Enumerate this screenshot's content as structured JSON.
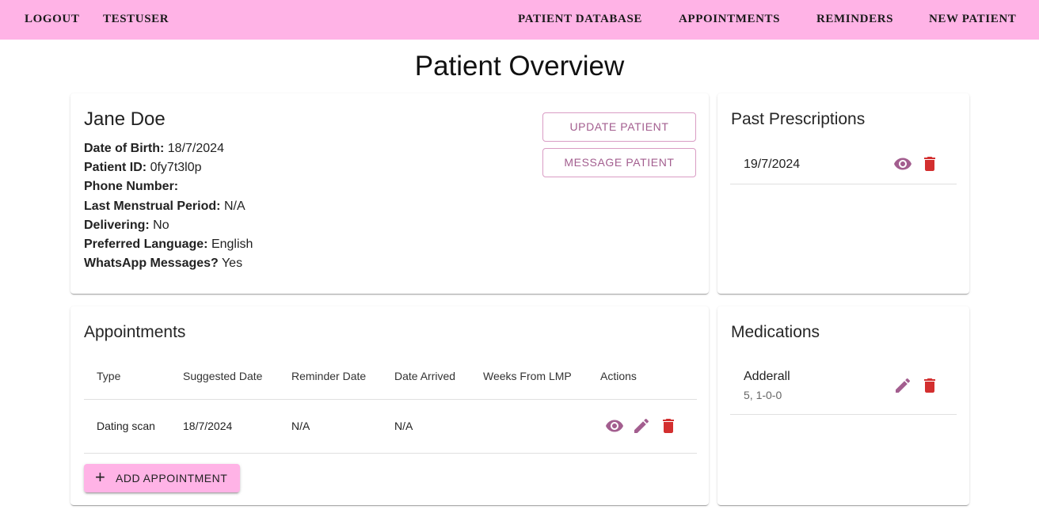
{
  "nav": {
    "logout": "LOGOUT",
    "user": "TESTUSER",
    "patient_database": "PATIENT DATABASE",
    "appointments": "APPOINTMENTS",
    "reminders": "REMINDERS",
    "new_patient": "NEW PATIENT"
  },
  "page": {
    "title": "Patient Overview"
  },
  "patient": {
    "name": "Jane Doe",
    "fields": [
      {
        "label": "Date of Birth:",
        "value": "18/7/2024"
      },
      {
        "label": "Patient ID:",
        "value": "0fy7t3l0p"
      },
      {
        "label": "Phone Number:",
        "value": ""
      },
      {
        "label": "Last Menstrual Period:",
        "value": "N/A"
      },
      {
        "label": "Delivering:",
        "value": "No"
      },
      {
        "label": "Preferred Language:",
        "value": "English"
      },
      {
        "label": "WhatsApp Messages?",
        "value": "Yes"
      }
    ],
    "update_label": "UPDATE PATIENT",
    "message_label": "MESSAGE PATIENT"
  },
  "appointments": {
    "title": "Appointments",
    "columns": [
      "Type",
      "Suggested Date",
      "Reminder Date",
      "Date Arrived",
      "Weeks From LMP",
      "Actions"
    ],
    "rows": [
      {
        "type": "Dating scan",
        "suggested": "18/7/2024",
        "reminder": "N/A",
        "arrived": "N/A",
        "weeks": ""
      }
    ],
    "add_label": "ADD APPOINTMENT"
  },
  "prescriptions": {
    "title": "Past Prescriptions",
    "items": [
      {
        "date": "19/7/2024"
      }
    ]
  },
  "medications": {
    "title": "Medications",
    "items": [
      {
        "name": "Adderall",
        "detail": "5, 1-0-0"
      }
    ]
  },
  "icons": {
    "view": "eye-icon",
    "edit": "pencil-icon",
    "delete": "trash-icon",
    "add": "plus-icon"
  },
  "colors": {
    "nav_bg": "#FFB3E6",
    "accent": "#A35E8F",
    "delete": "#D32F2F",
    "add_button_bg": "#FFB3E6"
  }
}
